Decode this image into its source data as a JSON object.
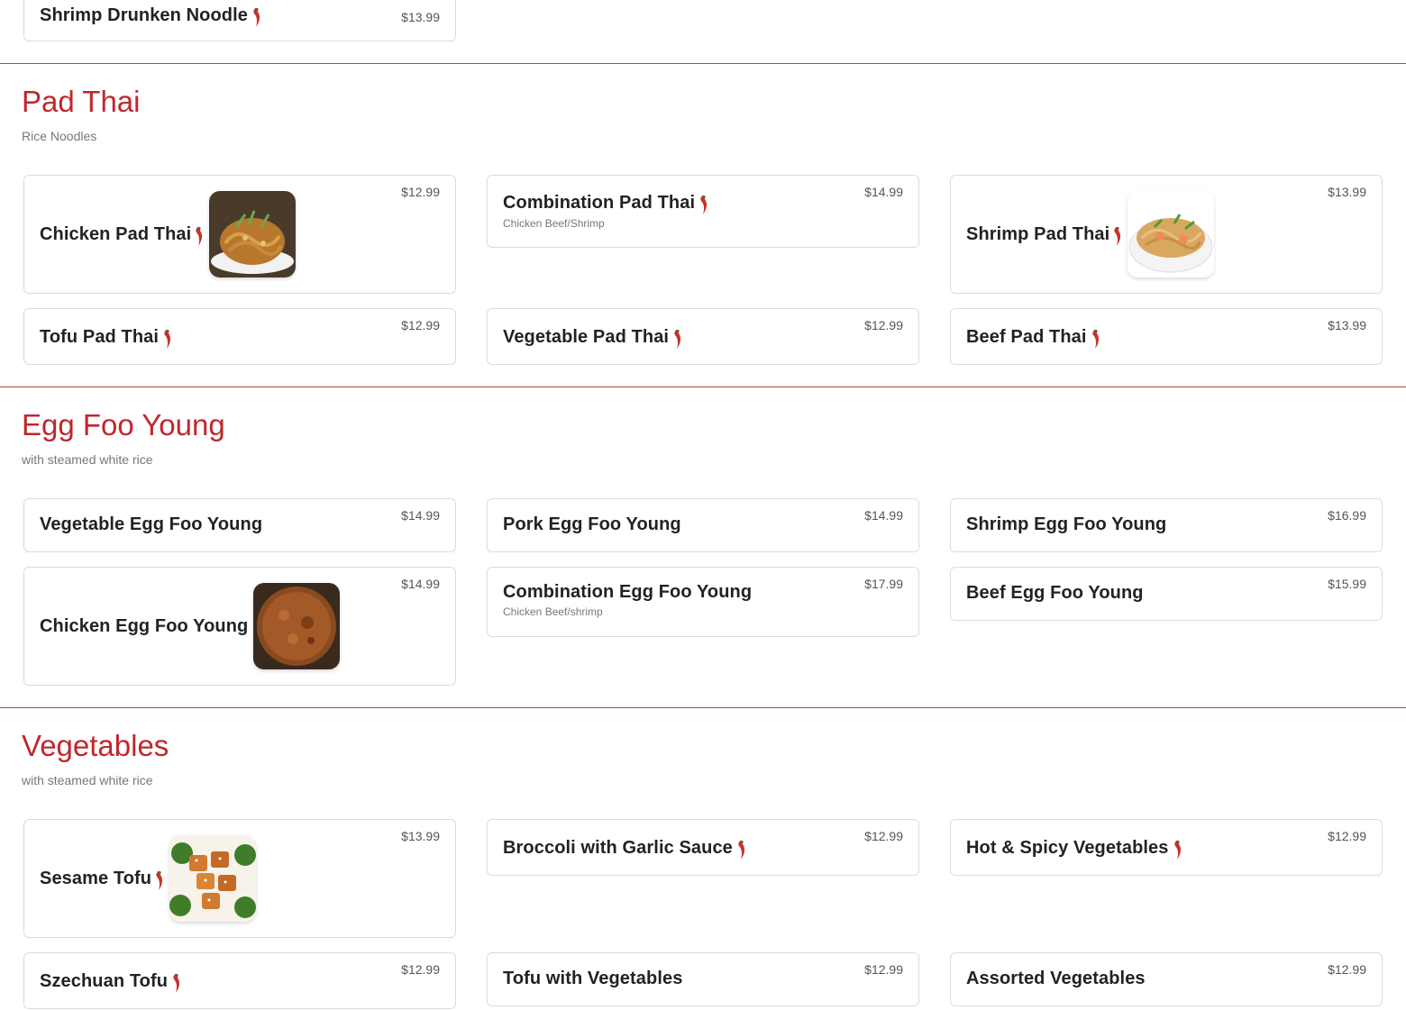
{
  "top_item": {
    "name": "Shrimp Drunken Noodle",
    "price": "$13.99"
  },
  "sections": [
    {
      "title": "Pad Thai",
      "subtitle": "Rice Noodles",
      "items": [
        {
          "name": "Chicken Pad Thai",
          "price": "$12.99",
          "spicy": true,
          "image": "pad-thai-photo"
        },
        {
          "name": "Combination Pad Thai",
          "price": "$14.99",
          "spicy": true,
          "desc": "Chicken Beef/Shrimp"
        },
        {
          "name": "Shrimp Pad Thai",
          "price": "$13.99",
          "spicy": true,
          "image": "shrimp-pad-thai-photo"
        },
        {
          "name": "Tofu Pad Thai",
          "price": "$12.99",
          "spicy": true
        },
        {
          "name": "Vegetable Pad Thai",
          "price": "$12.99",
          "spicy": true
        },
        {
          "name": "Beef Pad Thai",
          "price": "$13.99",
          "spicy": true
        }
      ]
    },
    {
      "title": "Egg Foo Young",
      "subtitle": "with steamed white rice",
      "items": [
        {
          "name": "Vegetable Egg Foo Young",
          "price": "$14.99"
        },
        {
          "name": "Pork Egg Foo Young",
          "price": "$14.99"
        },
        {
          "name": "Shrimp Egg Foo Young",
          "price": "$16.99"
        },
        {
          "name": "Chicken Egg Foo Young",
          "price": "$14.99",
          "image": "egg-foo-young-photo"
        },
        {
          "name": "Combination Egg Foo Young",
          "price": "$17.99",
          "desc": "Chicken Beef/shrimp"
        },
        {
          "name": "Beef Egg Foo Young",
          "price": "$15.99"
        }
      ]
    },
    {
      "title": "Vegetables",
      "subtitle": "with steamed white rice",
      "items": [
        {
          "name": "Sesame Tofu",
          "price": "$13.99",
          "spicy": true,
          "image": "sesame-tofu-photo"
        },
        {
          "name": "Broccoli with Garlic Sauce",
          "price": "$12.99",
          "spicy": true
        },
        {
          "name": "Hot & Spicy Vegetables",
          "price": "$12.99",
          "spicy": true
        },
        {
          "name": "Szechuan Tofu",
          "price": "$12.99",
          "spicy": true
        },
        {
          "name": "Tofu with Vegetables",
          "price": "$12.99"
        },
        {
          "name": "Assorted Vegetables",
          "price": "$12.99"
        }
      ]
    }
  ],
  "colors": {
    "accent": "#c0272d",
    "divider": "#c8393e",
    "chili": "#c8322a"
  },
  "icons": {
    "spicy": "chili-pepper-icon"
  }
}
